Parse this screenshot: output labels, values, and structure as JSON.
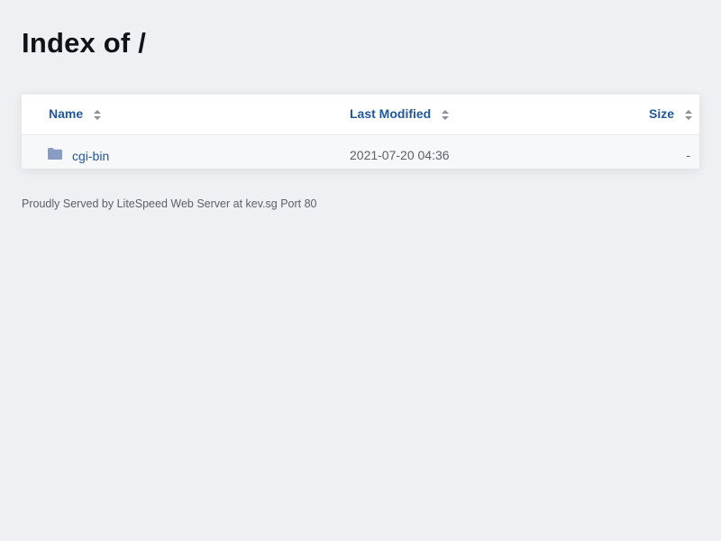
{
  "page": {
    "title": "Index of /"
  },
  "table": {
    "headers": {
      "name": "Name",
      "last_modified": "Last Modified",
      "size": "Size"
    },
    "sort_icon": "sort-arrows-icon",
    "rows": [
      {
        "icon": "folder-icon",
        "name": "cgi-bin",
        "last_modified": "2021-07-20 04:36",
        "size": "-"
      }
    ]
  },
  "footer": {
    "text": "Proudly Served by LiteSpeed Web Server at kev.sg Port 80"
  },
  "colors": {
    "background": "#eff0f3",
    "panel": "#ffffff",
    "link": "#23579b",
    "muted_text": "#5d6068",
    "folder": "#8a9cc4",
    "sort_arrow": "#8a8f9a"
  }
}
